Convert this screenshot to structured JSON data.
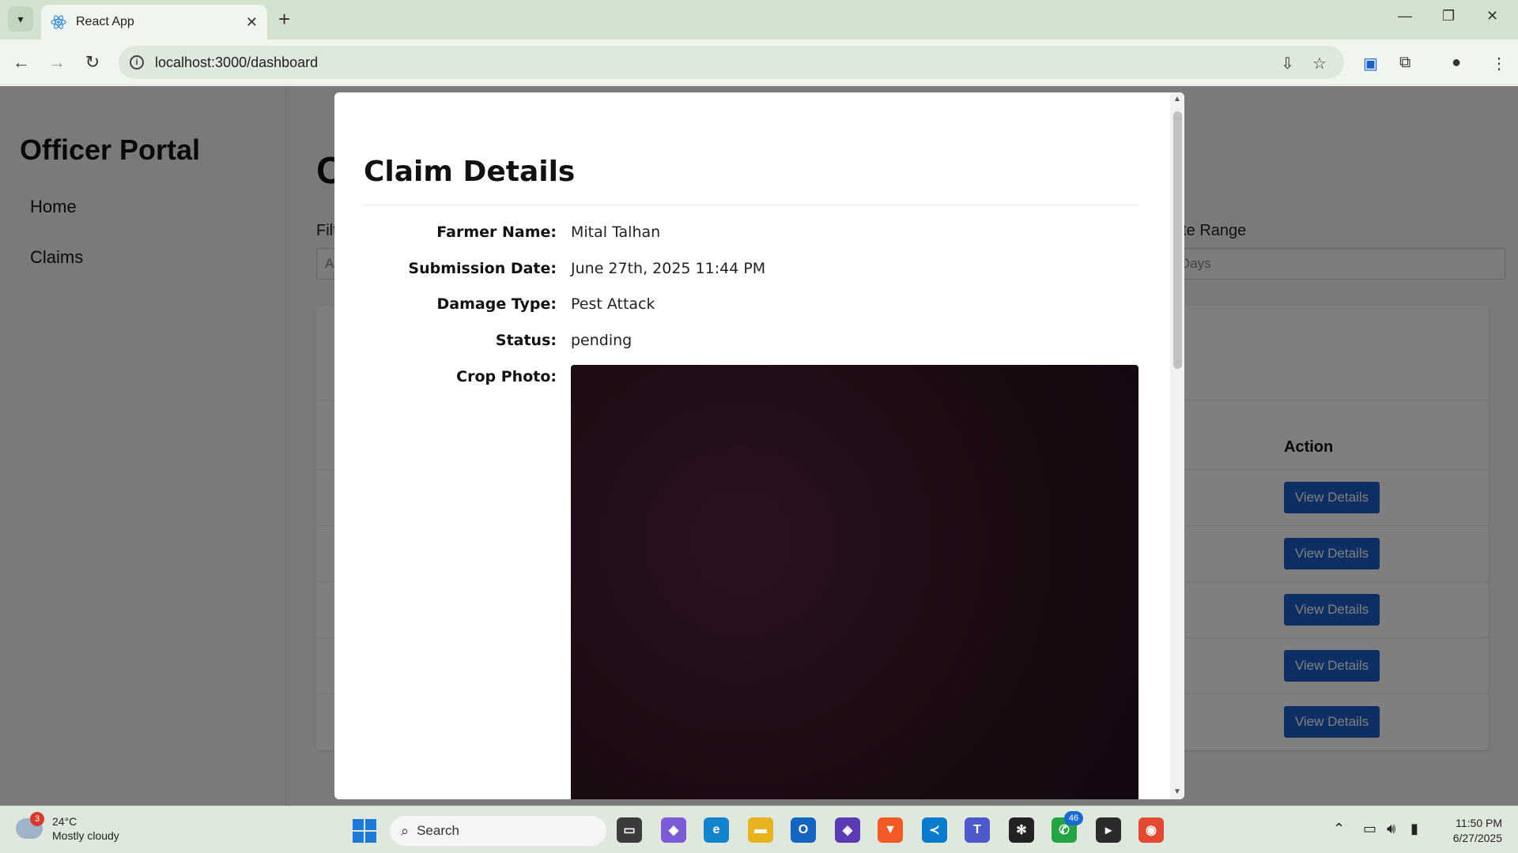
{
  "browser": {
    "tab_title": "React App",
    "url": "localhost:3000/dashboard"
  },
  "sidebar": {
    "title": "Officer Portal",
    "items": [
      {
        "label": "Home"
      },
      {
        "label": "Claims"
      }
    ]
  },
  "main": {
    "title_fragment": "C",
    "filter_label_fragment": "Filt",
    "filter_value_fragment": "A",
    "date_range_label_fragment": "ate Range",
    "date_range_value_fragment": "Days",
    "table": {
      "action_header": "Action",
      "row_button_label": "View Details",
      "row_count": 5
    }
  },
  "modal": {
    "title": "Claim Details",
    "fields": [
      {
        "label": "Farmer Name:",
        "value": "Mital Talhan"
      },
      {
        "label": "Submission Date:",
        "value": "June 27th, 2025 11:44 PM"
      },
      {
        "label": "Damage Type:",
        "value": "Pest Attack"
      },
      {
        "label": "Status:",
        "value": "pending"
      },
      {
        "label": "Crop Photo:",
        "value": ""
      }
    ]
  },
  "taskbar": {
    "weather_temp": "24°C",
    "weather_desc": "Mostly cloudy",
    "weather_badge": "3",
    "search_placeholder": "Search",
    "whatsapp_badge": "46",
    "time": "11:50 PM",
    "date": "6/27/2025"
  },
  "colors": {
    "accent": "#1a5ec9",
    "chrome": "#d3e3d0",
    "photo": "#1e0d16"
  }
}
